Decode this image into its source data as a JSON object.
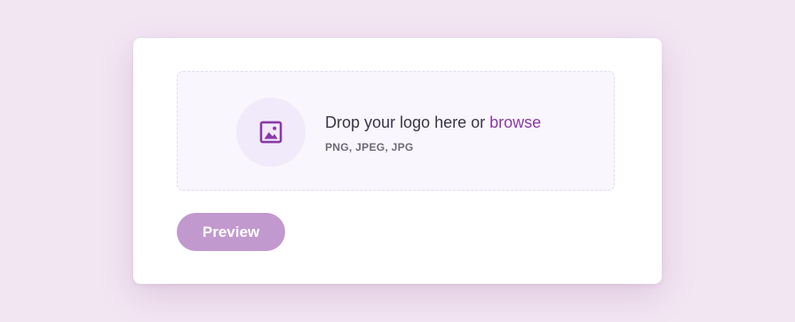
{
  "upload": {
    "title_prefix": "Drop your logo here or ",
    "browse_label": "browse",
    "formats": "PNG, JPEG, JPG",
    "icon": "image-icon"
  },
  "actions": {
    "preview_label": "Preview"
  },
  "colors": {
    "page_background": "#f3e6f3",
    "card_background": "#ffffff",
    "dropzone_background": "#f9f6fe",
    "icon_circle": "#f1eafb",
    "accent": "#8a3aa6",
    "button_background": "#c299cf"
  }
}
